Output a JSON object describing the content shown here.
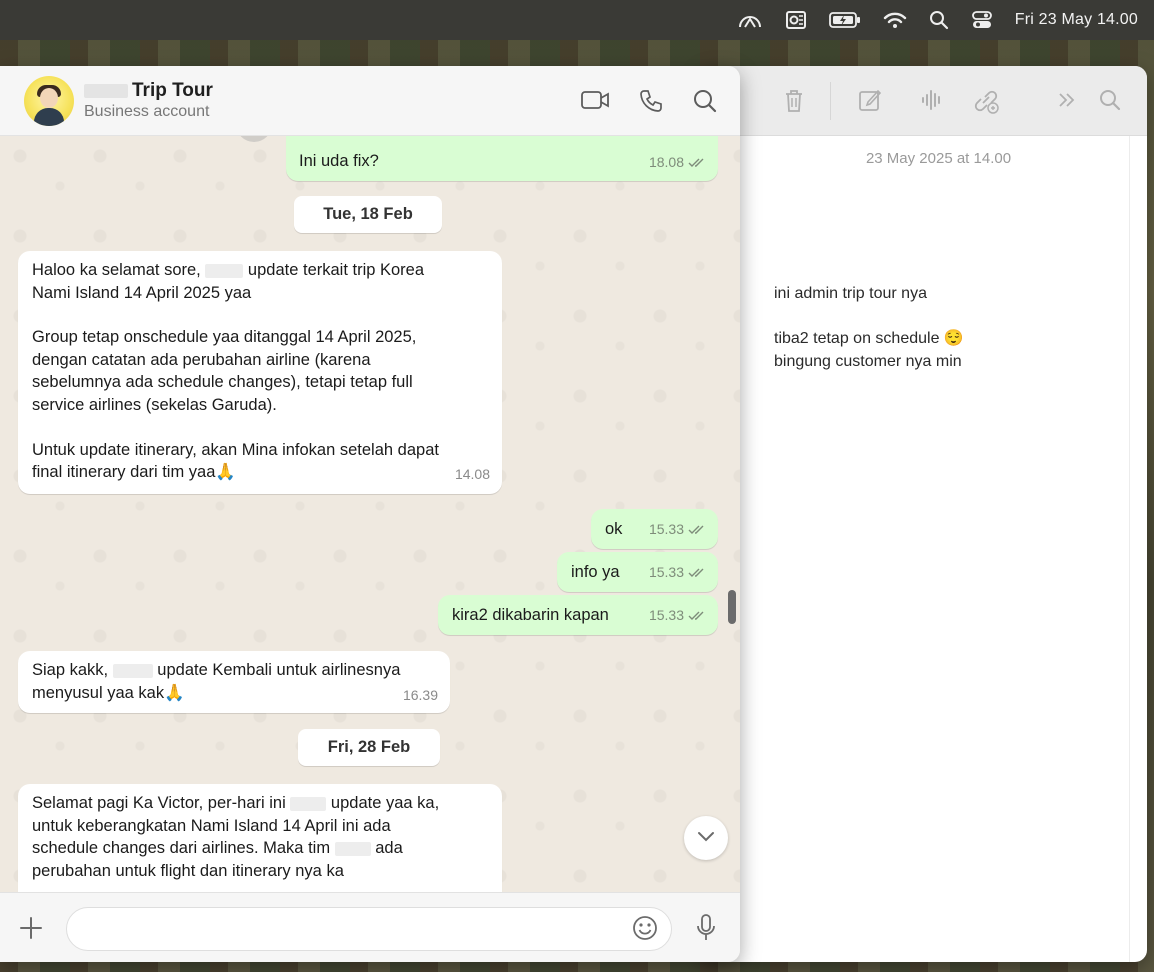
{
  "menubar": {
    "clock": "Fri 23 May  14.00",
    "icons": [
      "cloud-arc-icon",
      "outlook-icon",
      "battery-icon",
      "wifi-icon",
      "search-icon",
      "control-center-icon"
    ]
  },
  "notes": {
    "date": "23 May 2025 at 14.00",
    "lines": [
      "ini admin trip tour nya",
      "tiba2 tetap on schedule 😌",
      "bingung customer nya min"
    ],
    "toolbar_icons": [
      "trash-icon",
      "compose-icon",
      "audio-icon",
      "link-icon",
      "more-icon",
      "search-icon"
    ]
  },
  "header": {
    "name": "Trip Tour",
    "subtitle": "Business account"
  },
  "messages": [
    {
      "dir": "out",
      "text": "Ini uda fix?",
      "time": "18.08"
    },
    {
      "dir": "day",
      "text": "Tue, 18 Feb"
    },
    {
      "dir": "in",
      "lines": [
        "Haloo ka selamat sore, ",
        " update terkait trip Korea",
        "Nami Island 14 April 2025 yaa",
        "",
        "Group tetap onschedule yaa ditanggal 14 April 2025,",
        "dengan catatan ada perubahan airline (karena",
        "sebelumnya ada schedule changes), tetapi tetap full",
        "service airlines (sekelas Garuda).",
        "",
        "Untuk update itinerary, akan Mina infokan setelah dapat",
        "final itinerary dari tim yaa🙏"
      ],
      "time": "14.08"
    },
    {
      "dir": "out",
      "text": "ok",
      "time": "15.33"
    },
    {
      "dir": "out",
      "text": "info ya",
      "time": "15.33"
    },
    {
      "dir": "out",
      "text": "kira2 dikabarin kapan",
      "time": "15.33"
    },
    {
      "dir": "in",
      "lines": [
        "Siap kakk, ",
        " update Kembali untuk airlinesnya",
        "menyusul yaa kak🙏"
      ],
      "time": "16.39"
    },
    {
      "dir": "day",
      "text": "Fri, 28 Feb"
    },
    {
      "dir": "in",
      "lines": [
        "Selamat pagi Ka Victor, per-hari ini ",
        " update yaa ka,",
        "untuk keberangkatan Nami Island 14 April ini ada",
        "schedule changes dari airlines. Maka tim ",
        " ada",
        "perubahan untuk flight dan itinerary nya ka"
      ]
    }
  ],
  "composer": {
    "value": "",
    "placeholder": ""
  }
}
